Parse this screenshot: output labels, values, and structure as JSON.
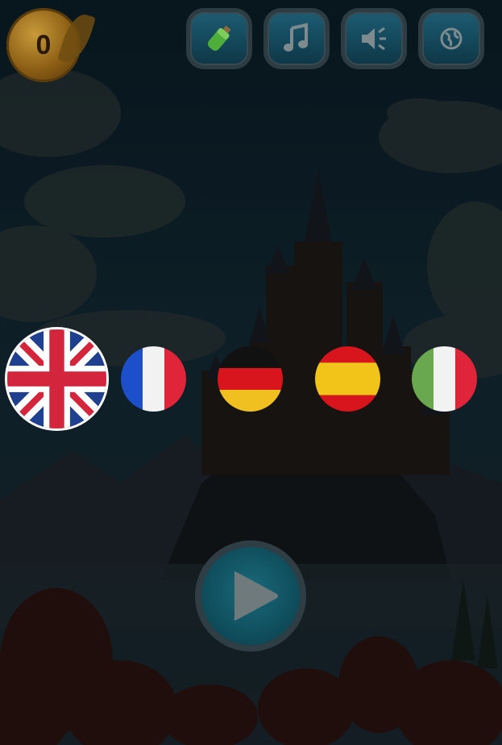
{
  "hud": {
    "coin_count": "0",
    "buttons": {
      "potion": "potion-bottle-icon",
      "music": "music-note-icon",
      "sound": "speaker-icon",
      "language": "globe-icon"
    }
  },
  "languages": [
    {
      "id": "uk",
      "flag": "united-kingdom-flag",
      "selected": true
    },
    {
      "id": "fr",
      "flag": "france-flag",
      "selected": false
    },
    {
      "id": "de",
      "flag": "germany-flag",
      "selected": false
    },
    {
      "id": "es",
      "flag": "spain-flag",
      "selected": false
    },
    {
      "id": "it",
      "flag": "italy-flag",
      "selected": false
    }
  ],
  "play": {
    "icon": "play-icon"
  },
  "colors": {
    "button_fill": "#1d5c73",
    "button_border": "#2c3c42",
    "selection_ring": "#ffffff",
    "coin": "#8a5d14"
  }
}
